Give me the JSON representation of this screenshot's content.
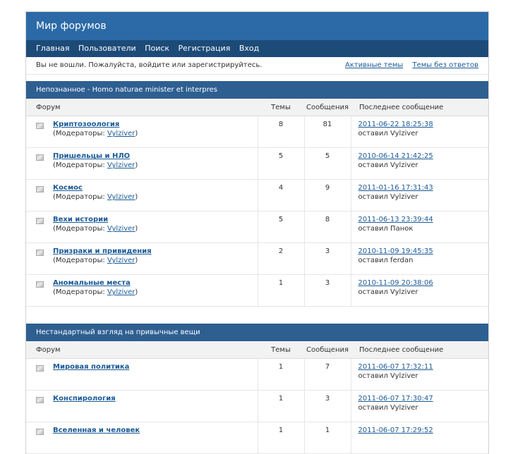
{
  "site": {
    "title": "Мир форумов"
  },
  "nav": {
    "items": [
      "Главная",
      "Пользователи",
      "Поиск",
      "Регистрация",
      "Вход"
    ]
  },
  "status": {
    "message": "Вы не вошли. Пожалуйста, войдите или зарегистрируйтесь.",
    "links": [
      "Активные темы",
      "Темы без ответов"
    ]
  },
  "headers": {
    "forum": "Форум",
    "topics": "Темы",
    "posts": "Сообщения",
    "last": "Последнее сообщение"
  },
  "categories": [
    {
      "title": "Непознанное - Homo naturae minister et interpres",
      "forums": [
        {
          "name": "Криптозоология",
          "mods_label": "(Модераторы: ",
          "moderator": "Vylziver",
          "close": ")",
          "topics": "8",
          "posts": "81",
          "last_date": "2011-06-22 18:25:38",
          "last_by": "оставил Vylziver"
        },
        {
          "name": "Пришельцы и НЛО",
          "mods_label": "(Модераторы: ",
          "moderator": "Vylziver",
          "close": ")",
          "topics": "5",
          "posts": "5",
          "last_date": "2010-06-14 21:42:25",
          "last_by": "оставил Vylziver"
        },
        {
          "name": "Космос",
          "mods_label": "(Модераторы: ",
          "moderator": "Vylziver",
          "close": ")",
          "topics": "4",
          "posts": "9",
          "last_date": "2011-01-16 17:31:43",
          "last_by": "оставил Vylziver"
        },
        {
          "name": "Вехи истории",
          "mods_label": "(Модераторы: ",
          "moderator": "Vylziver",
          "close": ")",
          "topics": "5",
          "posts": "8",
          "last_date": "2011-06-13 23:39:44",
          "last_by": "оставил Панок"
        },
        {
          "name": "Призраки и привидения",
          "mods_label": "(Модераторы: ",
          "moderator": "Vylziver",
          "close": ")",
          "topics": "2",
          "posts": "3",
          "last_date": "2010-11-09 19:45:35",
          "last_by": "оставил ferdan"
        },
        {
          "name": "Аномальные места",
          "mods_label": "(Модераторы: ",
          "moderator": "Vylziver",
          "close": ")",
          "topics": "1",
          "posts": "3",
          "last_date": "2010-11-09 20:38:06",
          "last_by": "оставил Vylziver"
        }
      ]
    },
    {
      "title": "Нестандартный взгляд на привычные вещи",
      "forums": [
        {
          "name": "Мировая политика",
          "topics": "1",
          "posts": "7",
          "last_date": "2011-06-07 17:32:11",
          "last_by": "оставил Vylziver"
        },
        {
          "name": "Конспирология",
          "topics": "1",
          "posts": "3",
          "last_date": "2011-06-07 17:30:47",
          "last_by": "оставил Vylziver"
        },
        {
          "name": "Вселенная и человек",
          "topics": "1",
          "posts": "1",
          "last_date": "2011-06-07 17:29:52",
          "last_by": ""
        }
      ]
    }
  ]
}
